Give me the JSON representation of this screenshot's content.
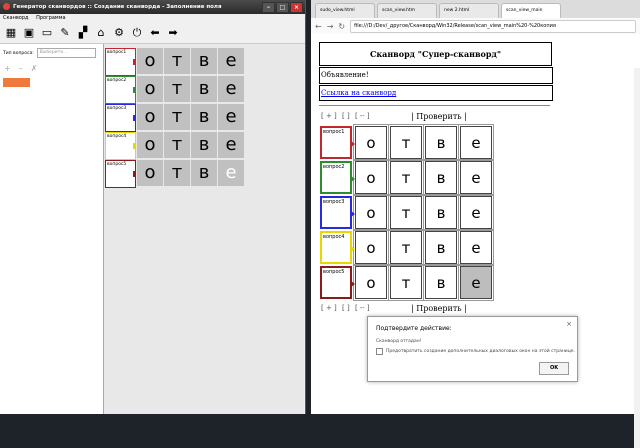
{
  "app": {
    "title": "Генератор сканвордов :: Создание сканворда - Заполнение поля",
    "menu": [
      "Сканворд",
      "Программа"
    ],
    "type_label": "Тип вопроса:",
    "type_placeholder": "Выберите...",
    "window_buttons": [
      "–",
      "□",
      "×"
    ],
    "icons": [
      "grid-icon",
      "save-icon",
      "open-icon",
      "pencil-icon",
      "layout-icon",
      "home-icon",
      "gear-icon",
      "power-icon",
      "arrow-left-icon",
      "arrow-right-icon"
    ],
    "add_controls": [
      "+",
      "–",
      "✗"
    ],
    "accent_color": "#f07a3c"
  },
  "grid": {
    "rows": [
      {
        "question": "вопрос1",
        "color": "#c0282d",
        "letters": [
          "о",
          "т",
          "в",
          "е"
        ]
      },
      {
        "question": "вопрос2",
        "color": "#2e8b2e",
        "letters": [
          "о",
          "т",
          "в",
          "е"
        ]
      },
      {
        "question": "вопрос3",
        "color": "#2a2adc",
        "letters": [
          "о",
          "т",
          "в",
          "е"
        ]
      },
      {
        "question": "вопрос4",
        "color": "#e8d800",
        "letters": [
          "о",
          "т",
          "в",
          "е"
        ]
      },
      {
        "question": "вопрос5",
        "color": "#8b1a1a",
        "letters": [
          "о",
          "т",
          "в",
          "е"
        ]
      }
    ]
  },
  "browser": {
    "tabs": [
      "sudo_view.html",
      "scan_view.htm",
      "new 2.html",
      "scan_view_main"
    ],
    "url": "file:///D:/Dev/_другое/Сканворд/Win32/Release/scan_view_main%20-%20копия",
    "page_title": "Сканворд \"Супер-сканворд\"",
    "announcement": "Объявление!",
    "link": "Ссылка на сканворд",
    "controls": [
      "[ + ]",
      "[ ]",
      "[ -- ]"
    ],
    "check_label": "| Проверить |",
    "dialog": {
      "title": "Подтвердите действие:",
      "message": "Сканворд отгадан!",
      "checkbox": "Предотвратить создание дополнительных диалоговых окон на этой странице.",
      "ok": "OK",
      "close": "×"
    }
  }
}
